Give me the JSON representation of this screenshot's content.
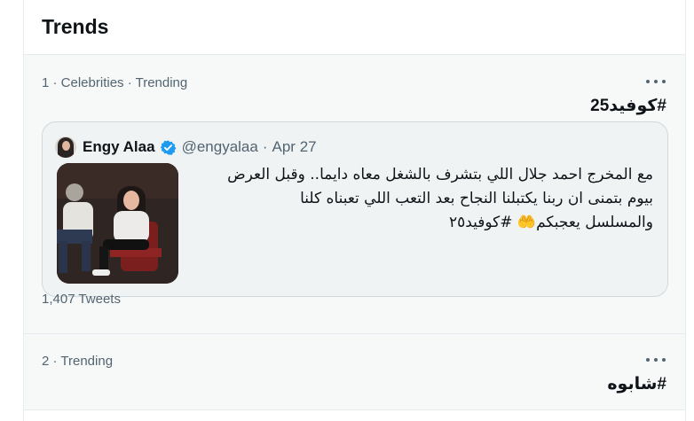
{
  "panel": {
    "title": "Trends"
  },
  "trends": [
    {
      "meta": "1 · Celebrities · Trending",
      "hashtag": "#كوفيد25",
      "more_icon": "more-horizontal-icon",
      "tweet": {
        "name": "Engy Alaa",
        "verified": true,
        "handle": "@engyalaa",
        "date": "Apr 27",
        "lines": [
          "مع المخرج احمد جلال اللي بتشرف بالشغل معاه دايما.. وقبل العرض",
          "بيوم بتمنى ان ربنا يكتبلنا النجاح بعد التعب اللي تعبناه كلنا",
          "والمسلسل يعجبكم🤲 #كوفيد٢٥"
        ]
      },
      "count": "1,407 Tweets"
    },
    {
      "meta": "2 · Trending",
      "hashtag": "#شابوه",
      "more_icon": "more-horizontal-icon"
    }
  ],
  "colors": {
    "secondary_text": "#536471",
    "verified_blue": "#1d9bf0",
    "card_background": "#eff3f4",
    "panel_background": "#f7f9f9"
  }
}
